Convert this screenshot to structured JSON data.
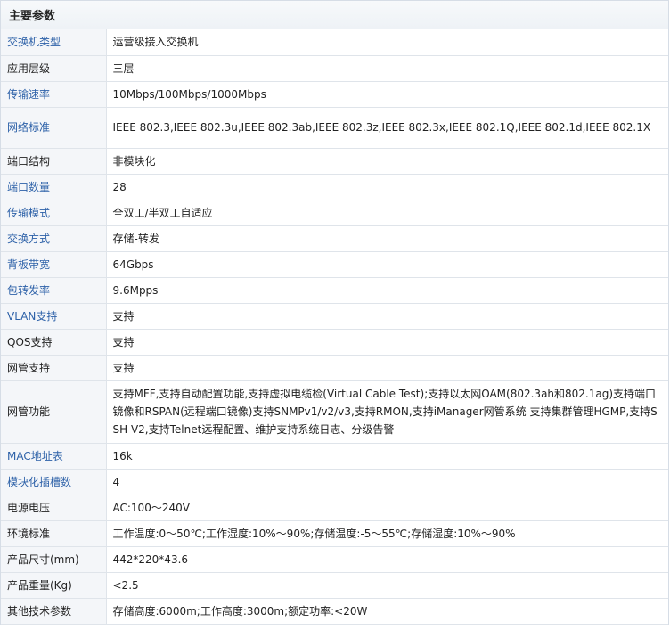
{
  "header": {
    "title": "主要参数"
  },
  "rows": [
    {
      "label": "交换机类型",
      "value": "运营级接入交换机",
      "link": true
    },
    {
      "label": "应用层级",
      "value": "三层",
      "link": false
    },
    {
      "label": "传输速率",
      "value": "10Mbps/100Mbps/1000Mbps",
      "link": true
    },
    {
      "label": "网络标准",
      "value": "IEEE 802.3,IEEE 802.3u,IEEE 802.3ab,IEEE 802.3z,IEEE 802.3x,IEEE 802.1Q,IEEE 802.1d,IEEE 802.1X",
      "link": true
    },
    {
      "label": "端口结构",
      "value": "非模块化",
      "link": false
    },
    {
      "label": "端口数量",
      "value": "28",
      "link": true
    },
    {
      "label": "传输模式",
      "value": "全双工/半双工自适应",
      "link": true
    },
    {
      "label": "交换方式",
      "value": "存储-转发",
      "link": true
    },
    {
      "label": "背板带宽",
      "value": "64Gbps",
      "link": true
    },
    {
      "label": "包转发率",
      "value": "9.6Mpps",
      "link": true
    },
    {
      "label": "VLAN支持",
      "value": "支持",
      "link": true
    },
    {
      "label": "QOS支持",
      "value": "支持",
      "link": false
    },
    {
      "label": "网管支持",
      "value": "支持",
      "link": false
    },
    {
      "label": "网管功能",
      "value": "支持MFF,支持自动配置功能,支持虚拟电缆检(Virtual Cable Test);支持以太网OAM(802.3ah和802.1ag)支持端口镜像和RSPAN(远程端口镜像)支持SNMPv1/v2/v3,支持RMON,支持iManager网管系统 支持集群管理HGMP,支持SSH V2,支持Telnet远程配置、维护支持系统日志、分级告警",
      "link": false
    },
    {
      "label": "MAC地址表",
      "value": "16k",
      "link": true
    },
    {
      "label": "模块化插槽数",
      "value": "4",
      "link": true
    },
    {
      "label": "电源电压",
      "value": "AC:100～240V",
      "link": false
    },
    {
      "label": "环境标准",
      "value": "工作温度:0～50℃;工作湿度:10%～90%;存储温度:-5～55℃;存储湿度:10%～90%",
      "link": false
    },
    {
      "label": "产品尺寸(mm)",
      "value": "442*220*43.6",
      "link": false
    },
    {
      "label": "产品重量(Kg)",
      "value": "<2.5",
      "link": false
    },
    {
      "label": "其他技术参数",
      "value": "存储高度:6000m;工作高度:3000m;额定功率:<20W",
      "link": false
    }
  ]
}
